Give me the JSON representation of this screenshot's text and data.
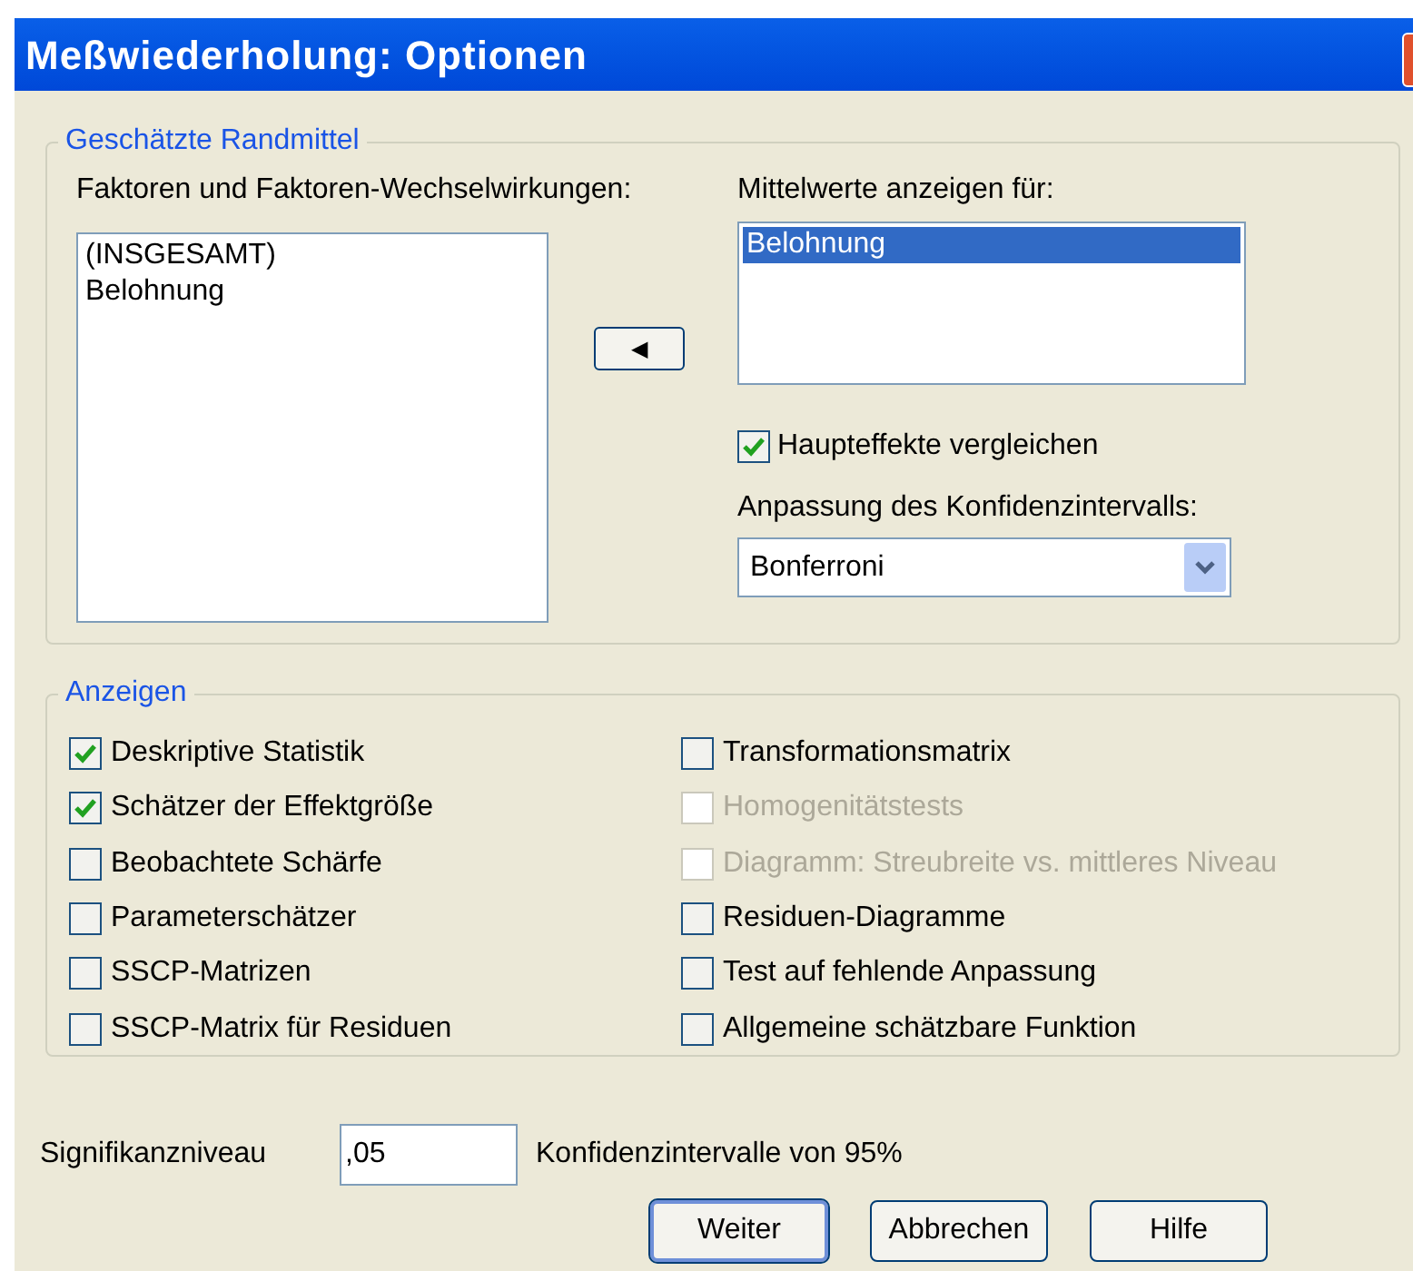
{
  "window": {
    "title": "Meßwiederholung: Optionen"
  },
  "estimated_marginal_means": {
    "title": "Geschätzte Randmittel",
    "factors_label": "Faktoren und Faktoren-Wechselwirkungen:",
    "factors": [
      {
        "label": "(INSGESAMT)",
        "selected": false
      },
      {
        "label": "Belohnung",
        "selected": false
      }
    ],
    "move_button": "◀",
    "display_means_label": "Mittelwerte anzeigen für:",
    "display_means": [
      {
        "label": "Belohnung",
        "selected": true
      }
    ],
    "compare_main_effects": {
      "label": "Haupteffekte vergleichen",
      "checked": true
    },
    "ci_adjustment_label": "Anpassung des Konfidenzintervalls:",
    "ci_adjustment": {
      "value": "Bonferroni"
    }
  },
  "display": {
    "title": "Anzeigen",
    "options": [
      {
        "label": "Deskriptive Statistik",
        "checked": true,
        "disabled": false
      },
      {
        "label": "Schätzer der Effektgröße",
        "checked": true,
        "disabled": false
      },
      {
        "label": "Beobachtete Schärfe",
        "checked": false,
        "disabled": false
      },
      {
        "label": "Parameterschätzer",
        "checked": false,
        "disabled": false
      },
      {
        "label": "SSCP-Matrizen",
        "checked": false,
        "disabled": false
      },
      {
        "label": "SSCP-Matrix für Residuen",
        "checked": false,
        "disabled": false
      },
      {
        "label": "Transformationsmatrix",
        "checked": false,
        "disabled": false
      },
      {
        "label": "Homogenitätstests",
        "checked": false,
        "disabled": true
      },
      {
        "label": "Diagramm: Streubreite vs. mittleres Niveau",
        "checked": false,
        "disabled": true
      },
      {
        "label": "Residuen-Diagramme",
        "checked": false,
        "disabled": false
      },
      {
        "label": "Test auf fehlende Anpassung",
        "checked": false,
        "disabled": false
      },
      {
        "label": "Allgemeine schätzbare Funktion",
        "checked": false,
        "disabled": false
      }
    ]
  },
  "significance": {
    "label": "Signifikanzniveau",
    "value": ",05",
    "note": "Konfidenzintervalle von 95%"
  },
  "buttons": [
    {
      "label": "Weiter",
      "default": true
    },
    {
      "label": "Abbrechen",
      "default": false
    },
    {
      "label": "Hilfe",
      "default": false
    }
  ]
}
